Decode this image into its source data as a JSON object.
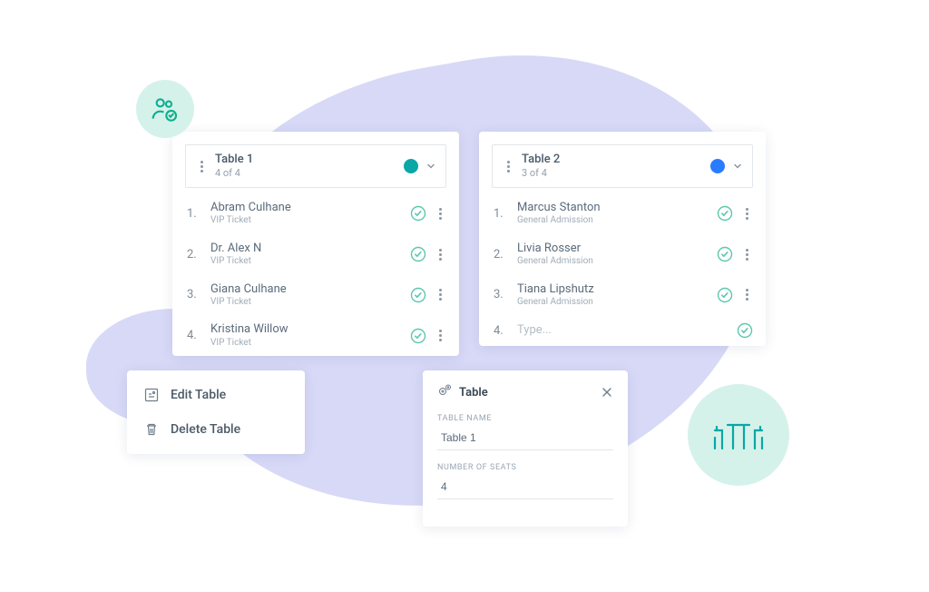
{
  "tableLeft": {
    "name": "Table 1",
    "count": "4 of 4",
    "colorClass": "teal",
    "seats": [
      {
        "num": "1.",
        "name": "Abram Culhane",
        "type": "VIP Ticket"
      },
      {
        "num": "2.",
        "name": "Dr. Alex N",
        "type": "VIP Ticket"
      },
      {
        "num": "3.",
        "name": "Giana Culhane",
        "type": "VIP Ticket"
      },
      {
        "num": "4.",
        "name": "Kristina Willow",
        "type": "VIP Ticket"
      }
    ]
  },
  "tableRight": {
    "name": "Table 2",
    "count": "3 of 4",
    "colorClass": "blue",
    "seats": [
      {
        "num": "1.",
        "name": "Marcus Stanton",
        "type": "General Admission"
      },
      {
        "num": "2.",
        "name": "Livia Rosser",
        "type": "General Admission"
      },
      {
        "num": "3.",
        "name": "Tiana Lipshutz",
        "type": "General Admission"
      }
    ],
    "empty": {
      "num": "4.",
      "placeholder": "Type..."
    }
  },
  "contextMenu": {
    "editLabel": "Edit Table",
    "deleteLabel": "Delete Table"
  },
  "panel": {
    "title": "Table",
    "nameLabel": "TABLE NAME",
    "nameValue": "Table 1",
    "seatsLabel": "NUMBER OF SEATS",
    "seatsValue": "4"
  }
}
